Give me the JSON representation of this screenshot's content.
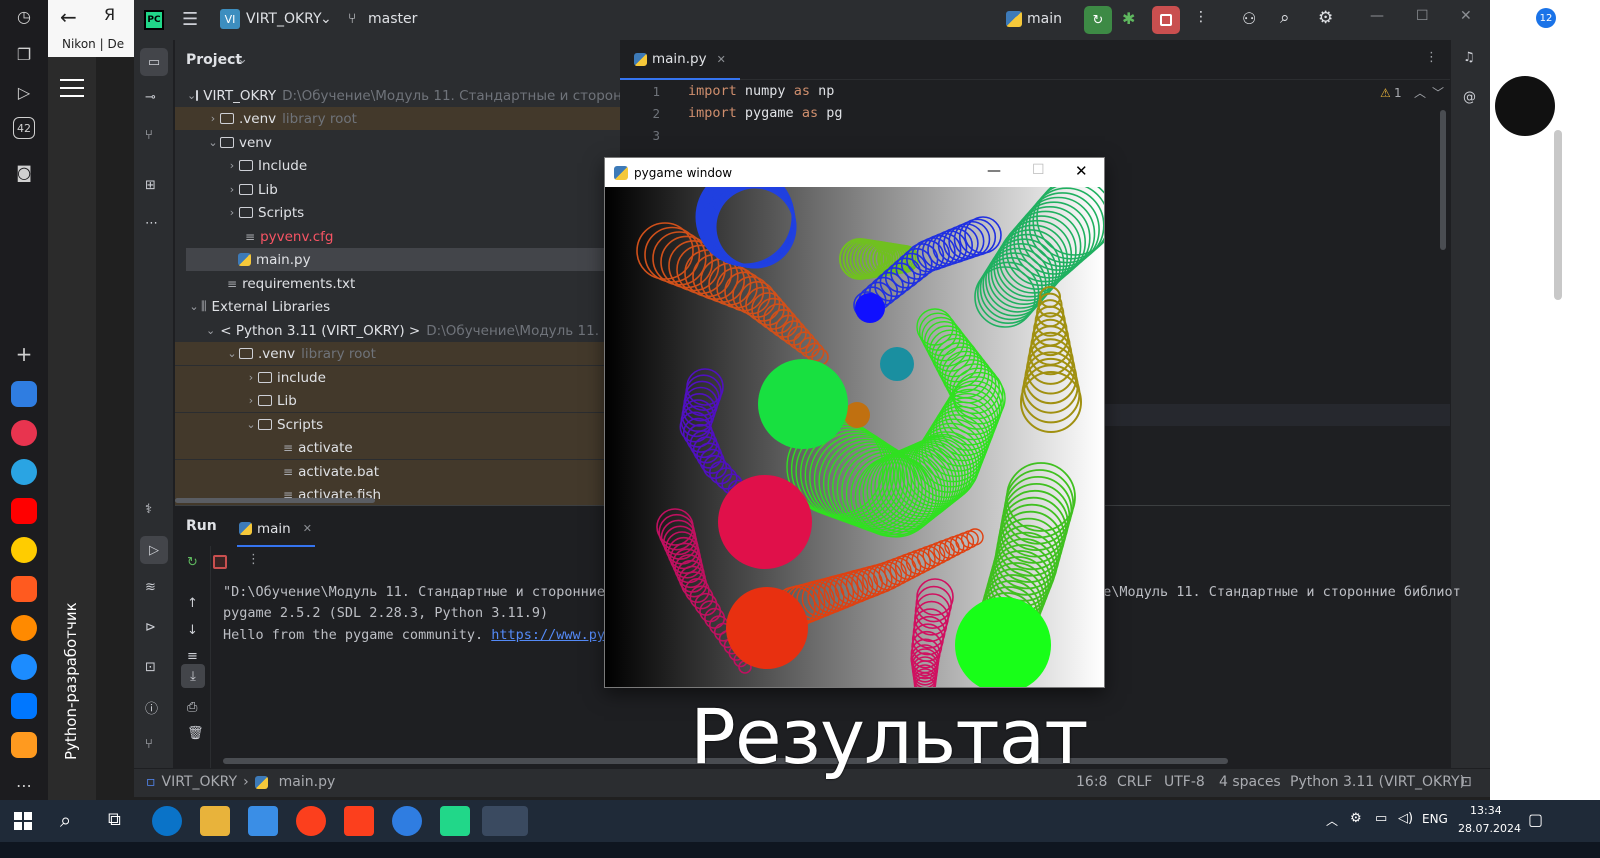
{
  "ide": {
    "project_badge": "VI",
    "project_name": "VIRT_OKRY",
    "branch": "master",
    "run_config": "main",
    "tool_window_title": "Project",
    "tree": [
      {
        "label": "VIRT_OKRY",
        "extra": "D:\\Обучение\\Модуль 11. Стандартные и сторонние"
      },
      {
        "label": ".venv",
        "extra": "library root"
      },
      {
        "label": "venv"
      },
      {
        "label": "Include"
      },
      {
        "label": "Lib"
      },
      {
        "label": "Scripts"
      },
      {
        "label": "pyvenv.cfg"
      },
      {
        "label": "main.py"
      },
      {
        "label": "requirements.txt"
      },
      {
        "label": "External Libraries"
      },
      {
        "label": "< Python 3.11 (VIRT_OKRY) >",
        "extra": "D:\\Обучение\\Модуль 11. Ста"
      },
      {
        "label": ".venv",
        "extra": "library root"
      },
      {
        "label": "include"
      },
      {
        "label": "Lib"
      },
      {
        "label": "Scripts"
      },
      {
        "label": "activate"
      },
      {
        "label": "activate.bat"
      },
      {
        "label": "activate.fish"
      }
    ],
    "editor_tab": "main.py",
    "warnings_count": "1",
    "code": [
      {
        "n": "1",
        "kw1": "import",
        "a": " numpy ",
        "kw2": "as",
        "b": " np"
      },
      {
        "n": "2",
        "kw1": "import",
        "a": " pygame ",
        "kw2": "as",
        "b": " pg"
      },
      {
        "n": "3",
        "kw1": "",
        "a": "",
        "kw2": "",
        "b": ""
      }
    ],
    "run_label": "Run",
    "run_tab": "main",
    "output": [
      "\"D:\\Обучение\\Модуль 11. Стандартные и сторонние б",
      "pygame 2.5.2 (SDL 2.28.3, Python 3.11.9)",
      "Hello from the pygame community. "
    ],
    "output_link": "https://www.pyga",
    "output_right": "ие\\Модуль 11. Стандартные и сторонние библиот",
    "status": {
      "breadcrumb_project": "VIRT_OKRY",
      "breadcrumb_file": "main.py",
      "position": "16:8",
      "line_sep": "CRLF",
      "encoding": "UTF-8",
      "indent": "4 spaces",
      "interpreter": "Python 3.11 (VIRT_OKRY)"
    }
  },
  "pygame_window": {
    "title": "pygame window"
  },
  "caption": "Результат",
  "browser": {
    "bookmark": "Nikon | De",
    "side_label": "Python-разработчик",
    "badge_42": "42",
    "notif_count": "12"
  },
  "taskbar": {
    "lang": "ENG",
    "time": "13:34",
    "date": "28.07.2024"
  }
}
